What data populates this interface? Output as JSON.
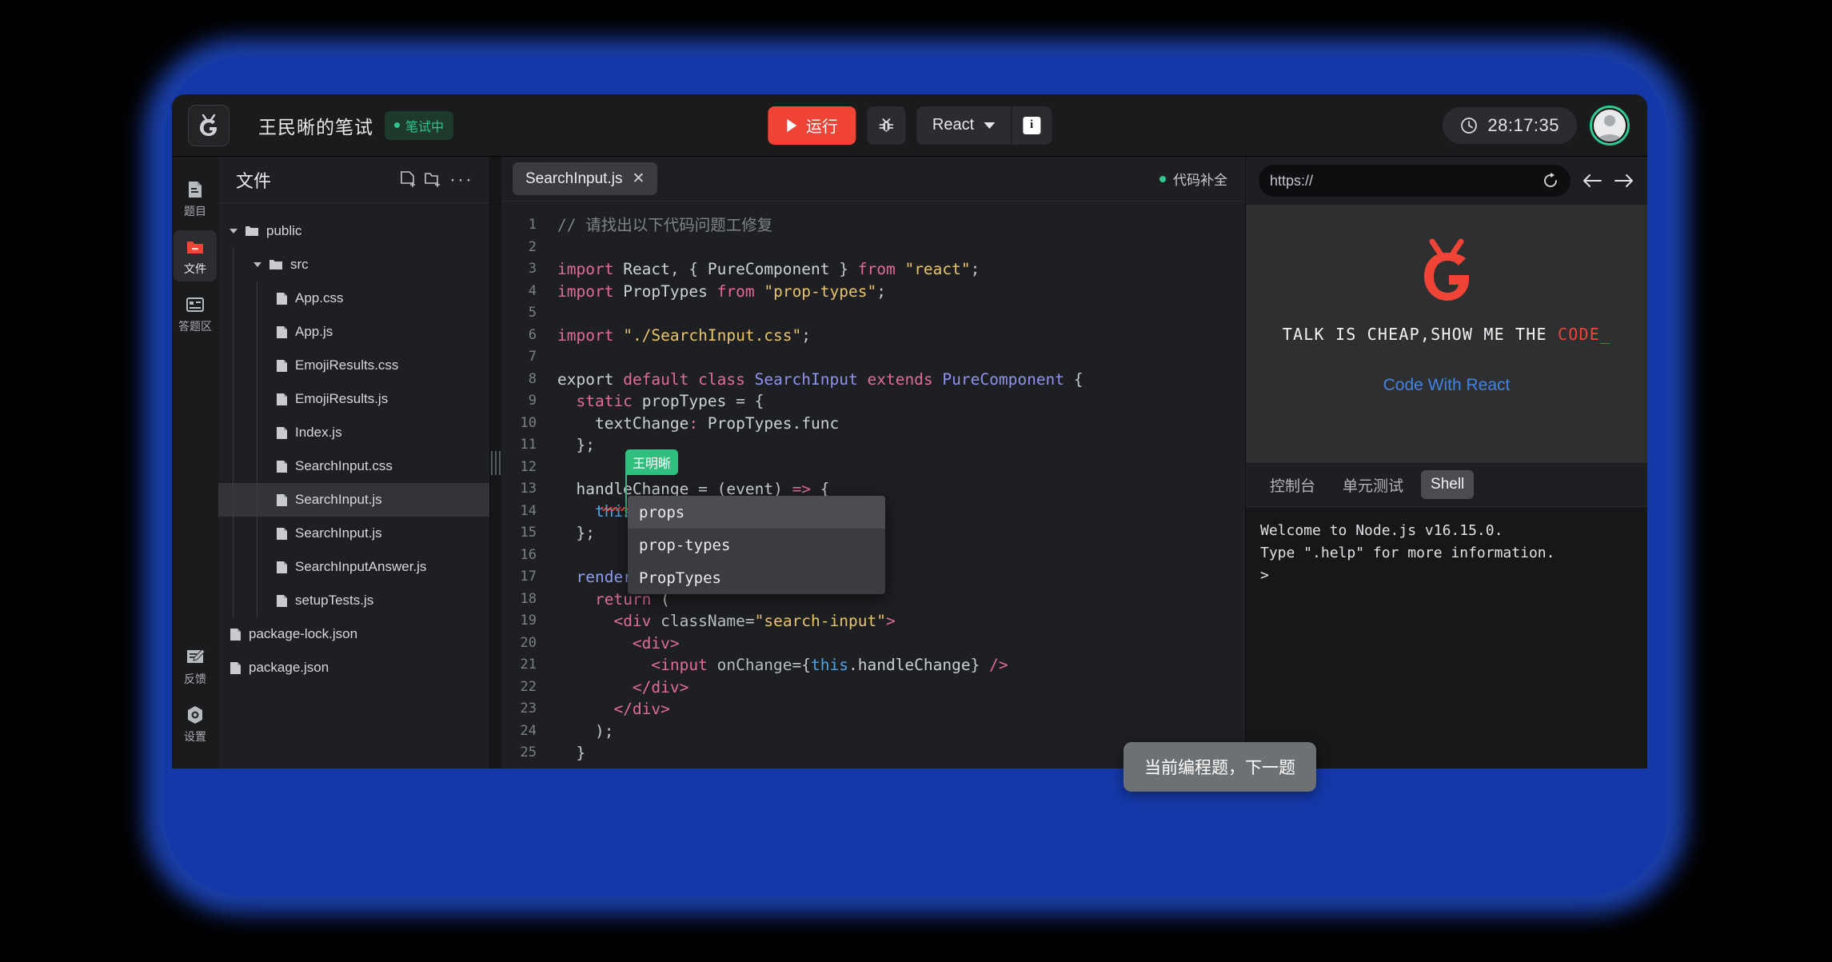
{
  "header": {
    "logo_name": "niuke-logo",
    "title": "王民晰的笔试",
    "status_badge": "笔试中",
    "run_label": "运行",
    "debug_icon": "bug-icon",
    "framework": "React",
    "info_label": "i",
    "timer": "28:17:35",
    "accent_red": "#f04437",
    "accent_green": "#31c48d"
  },
  "rail": {
    "items": [
      {
        "label": "题目",
        "icon": "document-icon",
        "active": false
      },
      {
        "label": "文件",
        "icon": "folder-icon",
        "active": true
      },
      {
        "label": "答题区",
        "icon": "answer-area-icon",
        "active": false
      }
    ],
    "bottom_items": [
      {
        "label": "反馈",
        "icon": "feedback-icon"
      },
      {
        "label": "设置",
        "icon": "settings-icon"
      }
    ]
  },
  "files": {
    "panel_title": "文件",
    "new_file_icon": "new-file-icon",
    "new_folder_icon": "new-folder-icon",
    "more_icon": "more-options-icon",
    "tree": [
      {
        "name": "public",
        "type": "folder",
        "depth": 0,
        "expanded": true,
        "selected": false
      },
      {
        "name": "src",
        "type": "folder",
        "depth": 1,
        "expanded": true,
        "selected": false
      },
      {
        "name": "App.css",
        "type": "file",
        "depth": 2,
        "selected": false
      },
      {
        "name": "App.js",
        "type": "file",
        "depth": 2,
        "selected": false
      },
      {
        "name": "EmojiResults.css",
        "type": "file",
        "depth": 2,
        "selected": false
      },
      {
        "name": "EmojiResults.js",
        "type": "file",
        "depth": 2,
        "selected": false
      },
      {
        "name": "Index.js",
        "type": "file",
        "depth": 2,
        "selected": false
      },
      {
        "name": "SearchInput.css",
        "type": "file",
        "depth": 2,
        "selected": false
      },
      {
        "name": "SearchInput.js",
        "type": "file",
        "depth": 2,
        "selected": true
      },
      {
        "name": "SearchInput.js",
        "type": "file",
        "depth": 2,
        "selected": false
      },
      {
        "name": "SearchInputAnswer.js",
        "type": "file",
        "depth": 2,
        "selected": false
      },
      {
        "name": "setupTests.js",
        "type": "file",
        "depth": 2,
        "selected": false
      },
      {
        "name": "package-lock.json",
        "type": "file",
        "depth": 0,
        "selected": false
      },
      {
        "name": "package.json",
        "type": "file",
        "depth": 0,
        "selected": false
      }
    ]
  },
  "editor": {
    "tab_label": "SearchInput.js",
    "tab_close_icon": "close-icon",
    "autocomplete_status": "代码补全",
    "collaborator_name": "王明晰",
    "lines": [
      {
        "n": "1",
        "html": "<span class='cmt'>// 请找出以下代码问题工修复</span>"
      },
      {
        "n": "2",
        "html": ""
      },
      {
        "n": "3",
        "html": "<span class='kw'>import</span> <span class='plain'>React</span><span class='punc'>, { </span><span class='plain'>PureComponent</span><span class='punc'> } </span><span class='kw'>from</span> <span class='str'>\"react\"</span><span class='punc'>;</span>"
      },
      {
        "n": "4",
        "html": "<span class='kw'>import</span> <span class='plain'>PropTypes</span> <span class='kw'>from</span> <span class='str'>\"prop-types\"</span><span class='punc'>;</span>"
      },
      {
        "n": "5",
        "html": ""
      },
      {
        "n": "6",
        "html": "<span class='kw'>import</span> <span class='str'>\"./SearchInput.css\"</span><span class='punc'>;</span>"
      },
      {
        "n": "7",
        "html": ""
      },
      {
        "n": "8",
        "html": "<span class='plain'>export</span> <span class='kw'>default</span> <span class='kw'>class</span> <span class='cls'>SearchInput</span> <span class='kw'>extends</span> <span class='cls'>PureComponent</span> <span class='punc'>{</span>"
      },
      {
        "n": "9",
        "html": "  <span class='kw'>static</span> <span class='plain'>propTypes</span> <span class='punc'>= {</span>"
      },
      {
        "n": "10",
        "html": "    <span class='plain'>textChange</span><span class='kw'>:</span> <span class='plain'>PropTypes.func</span>"
      },
      {
        "n": "11",
        "html": "  <span class='punc'>};</span>"
      },
      {
        "n": "12",
        "html": ""
      },
      {
        "n": "13",
        "html": "  <span class='plain'>handleChange</span> <span class='punc'>= (</span><span class='plain'>event</span><span class='punc'>)</span> <span class='kw'>=&gt;</span> <span class='punc'>{</span>"
      },
      {
        "n": "14",
        "html": "    <span class='th'>this</span><span class='punc'>..</span><span class='cls'>textChange</span><span class='punc'>(</span><span class='plain'>event</span><span class='punc'>);</span>"
      },
      {
        "n": "15",
        "html": "  <span class='punc'>};</span>"
      },
      {
        "n": "16",
        "html": ""
      },
      {
        "n": "17",
        "html": "  <span class='fn'>render</span><span class='punc'>() {</span>"
      },
      {
        "n": "18",
        "html": "    <span class='kw'>return</span> <span class='punc'>(</span>"
      },
      {
        "n": "19",
        "html": "      <span class='tag'>&lt;div</span> <span class='attr'>className</span><span class='punc'>=</span><span class='str'>\"search-input\"</span><span class='tag'>&gt;</span>"
      },
      {
        "n": "20",
        "html": "        <span class='tag'>&lt;div&gt;</span>"
      },
      {
        "n": "21",
        "html": "          <span class='tag'>&lt;input</span> <span class='attr'>onChange</span><span class='punc'>={</span><span class='th'>this</span><span class='punc'>.</span><span class='plain'>handleChange</span><span class='punc'>}</span> <span class='tag'>/&gt;</span>"
      },
      {
        "n": "22",
        "html": "        <span class='tag'>&lt;/div&gt;</span>"
      },
      {
        "n": "23",
        "html": "      <span class='tag'>&lt;/div&gt;</span>"
      },
      {
        "n": "24",
        "html": "    <span class='punc'>);</span>"
      },
      {
        "n": "25",
        "html": "  <span class='punc'>}</span>"
      }
    ],
    "autocomplete": {
      "items": [
        "props",
        "prop-types",
        "PropTypes"
      ],
      "selected_index": 0
    }
  },
  "preview": {
    "url_value": "https://",
    "refresh_icon": "refresh-icon",
    "back_icon": "arrow-left-icon",
    "forward_icon": "arrow-right-icon",
    "logo_name": "niuke-bug-logo",
    "tagline_white": "TALK IS CHEAP,SHOW ME THE ",
    "tagline_red": "CODE_",
    "link_text": "Code With React"
  },
  "console": {
    "tabs": [
      {
        "label": "控制台",
        "active": false
      },
      {
        "label": "单元测试",
        "active": false
      },
      {
        "label": "Shell",
        "active": true
      }
    ],
    "output": "Welcome to Node.js v16.15.0.\nType \".help\" for more information.\n>"
  },
  "tooltip": {
    "text": "当前编程题，下一题"
  }
}
